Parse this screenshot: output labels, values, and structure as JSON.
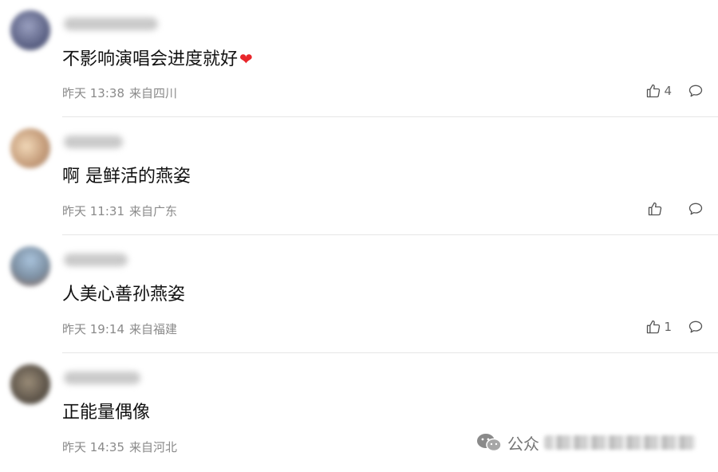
{
  "comments": [
    {
      "text": "不影响演唱会进度就好",
      "emoji": "❤",
      "time": "昨天 13:38",
      "location": "来自四川",
      "likes": "4",
      "avatar_color": "#6b6f8e"
    },
    {
      "text": "啊 是鲜活的燕姿",
      "time": "昨天 11:31",
      "location": "来自广东",
      "likes": "",
      "avatar_color": "#c9a98e"
    },
    {
      "text": "人美心善孙燕姿",
      "time": "昨天 19:14",
      "location": "来自福建",
      "likes": "1",
      "avatar_color": "#8ea2b6"
    },
    {
      "text": "正能量偶像",
      "time": "昨天 14:35",
      "location": "来自河北",
      "likes": "",
      "avatar_color": "#6f655a"
    }
  ],
  "watermark": {
    "text": "公众",
    "icon": "wechat-icon"
  }
}
